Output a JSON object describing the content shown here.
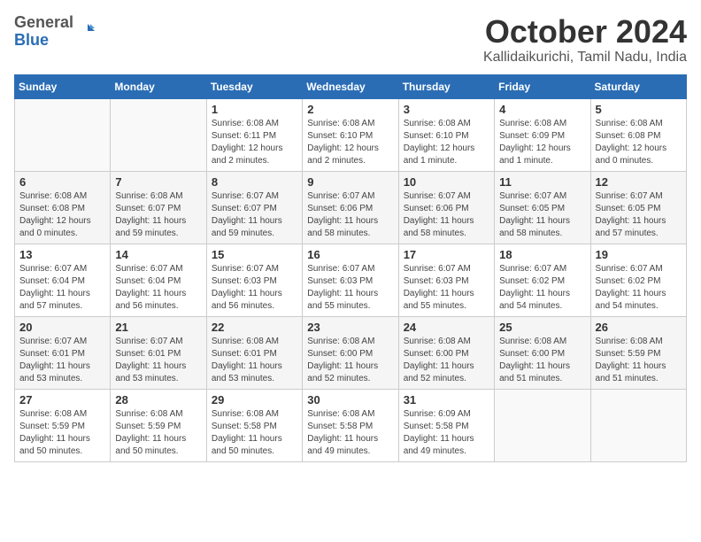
{
  "logo": {
    "general": "General",
    "blue": "Blue"
  },
  "header": {
    "month": "October 2024",
    "location": "Kallidaikurichi, Tamil Nadu, India"
  },
  "weekdays": [
    "Sunday",
    "Monday",
    "Tuesday",
    "Wednesday",
    "Thursday",
    "Friday",
    "Saturday"
  ],
  "weeks": [
    [
      {
        "day": "",
        "info": ""
      },
      {
        "day": "",
        "info": ""
      },
      {
        "day": "1",
        "info": "Sunrise: 6:08 AM\nSunset: 6:11 PM\nDaylight: 12 hours\nand 2 minutes."
      },
      {
        "day": "2",
        "info": "Sunrise: 6:08 AM\nSunset: 6:10 PM\nDaylight: 12 hours\nand 2 minutes."
      },
      {
        "day": "3",
        "info": "Sunrise: 6:08 AM\nSunset: 6:10 PM\nDaylight: 12 hours\nand 1 minute."
      },
      {
        "day": "4",
        "info": "Sunrise: 6:08 AM\nSunset: 6:09 PM\nDaylight: 12 hours\nand 1 minute."
      },
      {
        "day": "5",
        "info": "Sunrise: 6:08 AM\nSunset: 6:08 PM\nDaylight: 12 hours\nand 0 minutes."
      }
    ],
    [
      {
        "day": "6",
        "info": "Sunrise: 6:08 AM\nSunset: 6:08 PM\nDaylight: 12 hours\nand 0 minutes."
      },
      {
        "day": "7",
        "info": "Sunrise: 6:08 AM\nSunset: 6:07 PM\nDaylight: 11 hours\nand 59 minutes."
      },
      {
        "day": "8",
        "info": "Sunrise: 6:07 AM\nSunset: 6:07 PM\nDaylight: 11 hours\nand 59 minutes."
      },
      {
        "day": "9",
        "info": "Sunrise: 6:07 AM\nSunset: 6:06 PM\nDaylight: 11 hours\nand 58 minutes."
      },
      {
        "day": "10",
        "info": "Sunrise: 6:07 AM\nSunset: 6:06 PM\nDaylight: 11 hours\nand 58 minutes."
      },
      {
        "day": "11",
        "info": "Sunrise: 6:07 AM\nSunset: 6:05 PM\nDaylight: 11 hours\nand 58 minutes."
      },
      {
        "day": "12",
        "info": "Sunrise: 6:07 AM\nSunset: 6:05 PM\nDaylight: 11 hours\nand 57 minutes."
      }
    ],
    [
      {
        "day": "13",
        "info": "Sunrise: 6:07 AM\nSunset: 6:04 PM\nDaylight: 11 hours\nand 57 minutes."
      },
      {
        "day": "14",
        "info": "Sunrise: 6:07 AM\nSunset: 6:04 PM\nDaylight: 11 hours\nand 56 minutes."
      },
      {
        "day": "15",
        "info": "Sunrise: 6:07 AM\nSunset: 6:03 PM\nDaylight: 11 hours\nand 56 minutes."
      },
      {
        "day": "16",
        "info": "Sunrise: 6:07 AM\nSunset: 6:03 PM\nDaylight: 11 hours\nand 55 minutes."
      },
      {
        "day": "17",
        "info": "Sunrise: 6:07 AM\nSunset: 6:03 PM\nDaylight: 11 hours\nand 55 minutes."
      },
      {
        "day": "18",
        "info": "Sunrise: 6:07 AM\nSunset: 6:02 PM\nDaylight: 11 hours\nand 54 minutes."
      },
      {
        "day": "19",
        "info": "Sunrise: 6:07 AM\nSunset: 6:02 PM\nDaylight: 11 hours\nand 54 minutes."
      }
    ],
    [
      {
        "day": "20",
        "info": "Sunrise: 6:07 AM\nSunset: 6:01 PM\nDaylight: 11 hours\nand 53 minutes."
      },
      {
        "day": "21",
        "info": "Sunrise: 6:07 AM\nSunset: 6:01 PM\nDaylight: 11 hours\nand 53 minutes."
      },
      {
        "day": "22",
        "info": "Sunrise: 6:08 AM\nSunset: 6:01 PM\nDaylight: 11 hours\nand 53 minutes."
      },
      {
        "day": "23",
        "info": "Sunrise: 6:08 AM\nSunset: 6:00 PM\nDaylight: 11 hours\nand 52 minutes."
      },
      {
        "day": "24",
        "info": "Sunrise: 6:08 AM\nSunset: 6:00 PM\nDaylight: 11 hours\nand 52 minutes."
      },
      {
        "day": "25",
        "info": "Sunrise: 6:08 AM\nSunset: 6:00 PM\nDaylight: 11 hours\nand 51 minutes."
      },
      {
        "day": "26",
        "info": "Sunrise: 6:08 AM\nSunset: 5:59 PM\nDaylight: 11 hours\nand 51 minutes."
      }
    ],
    [
      {
        "day": "27",
        "info": "Sunrise: 6:08 AM\nSunset: 5:59 PM\nDaylight: 11 hours\nand 50 minutes."
      },
      {
        "day": "28",
        "info": "Sunrise: 6:08 AM\nSunset: 5:59 PM\nDaylight: 11 hours\nand 50 minutes."
      },
      {
        "day": "29",
        "info": "Sunrise: 6:08 AM\nSunset: 5:58 PM\nDaylight: 11 hours\nand 50 minutes."
      },
      {
        "day": "30",
        "info": "Sunrise: 6:08 AM\nSunset: 5:58 PM\nDaylight: 11 hours\nand 49 minutes."
      },
      {
        "day": "31",
        "info": "Sunrise: 6:09 AM\nSunset: 5:58 PM\nDaylight: 11 hours\nand 49 minutes."
      },
      {
        "day": "",
        "info": ""
      },
      {
        "day": "",
        "info": ""
      }
    ]
  ]
}
